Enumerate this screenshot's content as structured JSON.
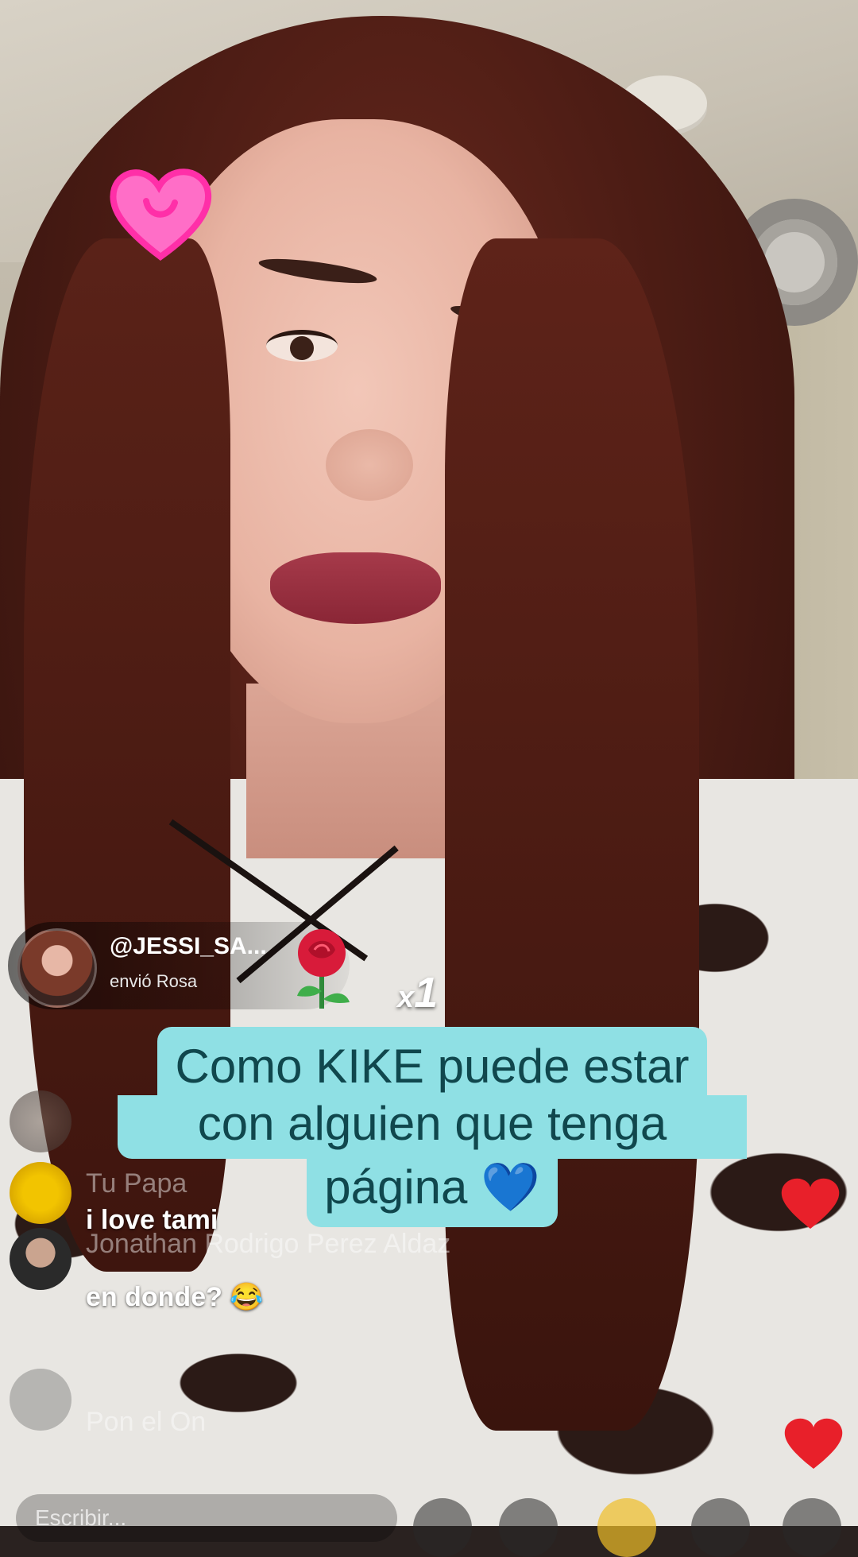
{
  "gift": {
    "username": "@JESSI_SA...",
    "action": "envió Rosa",
    "count_prefix": "x",
    "count": "1"
  },
  "caption": {
    "line1": "Como KIKE puede estar",
    "line2": "con alguien que tenga",
    "line3": "página 💙"
  },
  "comments": [
    {
      "text": "i love tami"
    },
    {
      "text": "en donde? 😂"
    }
  ],
  "faded_comments": [
    "Jonathan Rodrigo Perez Aldaz",
    "Tu Papa",
    "Pon el On"
  ],
  "bottom": {
    "input_placeholder": "Escribir..."
  },
  "colors": {
    "caption_bg": "#8fe0e4",
    "caption_text": "#10474d",
    "heart": "#e8202a"
  }
}
